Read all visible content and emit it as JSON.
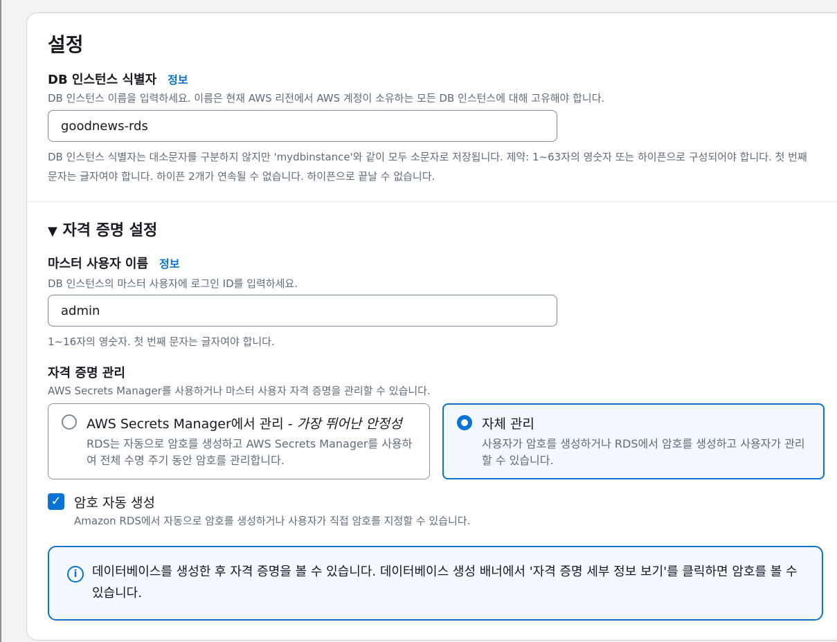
{
  "settings": {
    "title": "설정",
    "db_identifier": {
      "label": "DB 인스턴스 식별자",
      "info": "정보",
      "description": "DB 인스턴스 이름을 입력하세요. 이름은 현재 AWS 리전에서 AWS 계정이 소유하는 모든 DB 인스턴스에 대해 고유해야 합니다.",
      "value": "goodnews-rds",
      "constraint": "DB 인스턴스 식별자는 대소문자를 구분하지 않지만 'mydbinstance'와 같이 모두 소문자로 저장됩니다. 제약: 1~63자의 영숫자 또는 하이픈으로 구성되어야 합니다. 첫 번째 문자는 글자여야 합니다. 하이픈 2개가 연속될 수 없습니다. 하이픈으로 끝날 수 없습니다."
    }
  },
  "credentials": {
    "section_title": "자격 증명 설정",
    "toggle_glyph": "▼",
    "master_username": {
      "label": "마스터 사용자 이름",
      "info": "정보",
      "description": "DB 인스턴스의 마스터 사용자에 로그인 ID를 입력하세요.",
      "value": "admin",
      "constraint": "1~16자의 영숫자. 첫 번째 문자는 글자여야 합니다."
    },
    "management": {
      "label": "자격 증명 관리",
      "description": "AWS Secrets Manager를 사용하거나 마스터 사용자 자격 증명을 관리할 수 있습니다.",
      "options": [
        {
          "title": "AWS Secrets Manager에서 관리 - ",
          "title_emphasis": "가장 뛰어난 안정성",
          "description": "RDS는 자동으로 암호를 생성하고 AWS Secrets Manager를 사용하여 전체 수명 주기 동안 암호를 관리합니다.",
          "selected": false
        },
        {
          "title": "자체 관리",
          "description": "사용자가 암호를 생성하거나 RDS에서 암호를 생성하고 사용자가 관리할 수 있습니다.",
          "selected": true
        }
      ]
    },
    "auto_generate": {
      "label": "암호 자동 생성",
      "description": "Amazon RDS에서 자동으로 암호를 생성하거나 사용자가 직접 암호를 지정할 수 있습니다.",
      "checked": true,
      "check_glyph": "✓"
    },
    "alert": {
      "icon": "info-icon",
      "icon_glyph": "i",
      "text": "데이터베이스를 생성한 후 자격 증명을 볼 수 있습니다. 데이터베이스 생성 배너에서 '자격 증명 세부 정보 보기'를 클릭하면 암호를 볼 수 있습니다."
    }
  },
  "colors": {
    "accent": "#0972d3",
    "selected_bg": "#f2f8fd",
    "muted_text": "#5f6b7a"
  }
}
